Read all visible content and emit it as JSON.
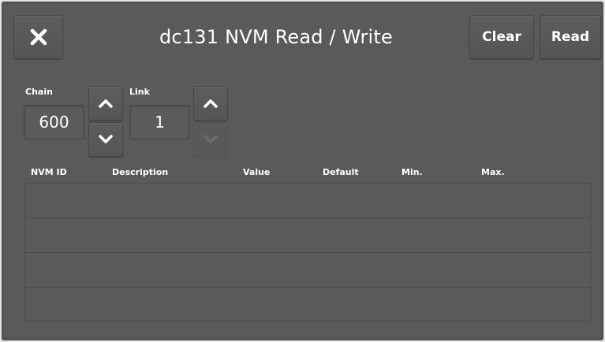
{
  "header": {
    "title": "dc131 NVM Read / Write",
    "close_icon": "close-icon",
    "clear_label": "Clear",
    "read_label": "Read"
  },
  "chain": {
    "label": "Chain",
    "value": "600",
    "up_icon": "chevron-up-icon",
    "down_icon": "chevron-down-icon"
  },
  "link": {
    "label": "Link",
    "value": "1",
    "up_icon": "chevron-up-icon",
    "down_icon": "chevron-down-icon",
    "down_disabled": true
  },
  "table": {
    "columns": [
      "NVM ID",
      "Description",
      "Value",
      "Default",
      "Min.",
      "Max."
    ],
    "rows": [
      [
        "",
        "",
        "",
        "",
        "",
        ""
      ],
      [
        "",
        "",
        "",
        "",
        "",
        ""
      ],
      [
        "",
        "",
        "",
        "",
        "",
        ""
      ],
      [
        "",
        "",
        "",
        "",
        "",
        ""
      ]
    ]
  },
  "colors": {
    "background": "#5a5a5a",
    "text": "#ffffff",
    "disabled_icon": "#6b6b6b"
  }
}
